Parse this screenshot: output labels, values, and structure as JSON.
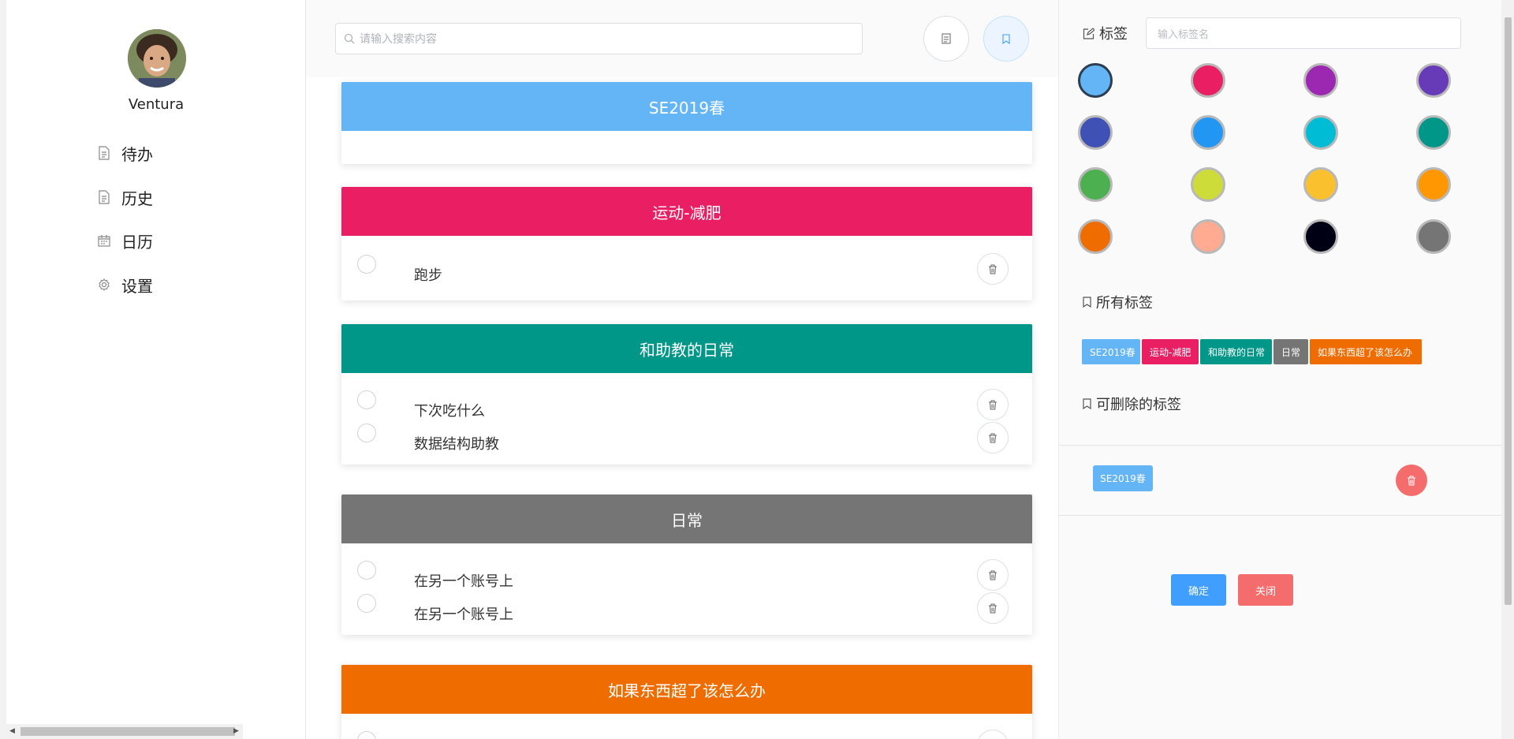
{
  "sidebar": {
    "username": "Ventura",
    "nav": [
      {
        "label": "待办",
        "icon": "document-icon"
      },
      {
        "label": "历史",
        "icon": "document-icon"
      },
      {
        "label": "日历",
        "icon": "calendar-icon"
      },
      {
        "label": "设置",
        "icon": "gear-icon"
      }
    ]
  },
  "search": {
    "placeholder": "请输入搜索内容"
  },
  "cards": [
    {
      "title": "SE2019春",
      "color": "#64b5f6",
      "todos": []
    },
    {
      "title": "运动-减肥",
      "color": "#e91e63",
      "todos": [
        "跑步"
      ]
    },
    {
      "title": "和助教的日常",
      "color": "#009688",
      "todos": [
        "下次吃什么",
        "数据结构助教"
      ]
    },
    {
      "title": "日常",
      "color": "#757575",
      "todos": [
        "在另一个账号上",
        "在另一个账号上"
      ]
    },
    {
      "title": "如果东西超了该怎么办",
      "color": "#ef6c00",
      "todos": [
        ""
      ]
    }
  ],
  "tag_panel": {
    "title": "标签",
    "name_placeholder": "输入标签名",
    "colors": [
      "#64b5f6",
      "#e91e63",
      "#9c27b0",
      "#673ab7",
      "#3f51b5",
      "#2196f3",
      "#00bcd4",
      "#009688",
      "#4caf50",
      "#cddc39",
      "#fbc02d",
      "#ff9800",
      "#ef6c00",
      "#ffab91",
      "#000014",
      "#757575"
    ],
    "selected_color": "#64b5f6",
    "all_tags_title": "所有标签",
    "all_tags": [
      {
        "label": "SE2019春",
        "color": "#64b5f6"
      },
      {
        "label": "运动-减肥",
        "color": "#e91e63"
      },
      {
        "label": "和助教的日常",
        "color": "#009688"
      },
      {
        "label": "日常",
        "color": "#757575"
      },
      {
        "label": "如果东西超了该怎么办",
        "color": "#ef6c00"
      }
    ],
    "deletable_title": "可删除的标签",
    "deletable_tag": {
      "label": "SE2019春",
      "color": "#64b5f6"
    },
    "confirm_label": "确定",
    "close_label": "关闭",
    "confirm_color": "#409eff",
    "close_color": "#f56c6c"
  }
}
